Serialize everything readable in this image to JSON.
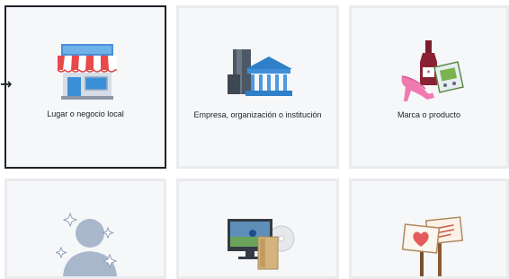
{
  "categories": [
    {
      "label": "Lugar o negocio local",
      "icon": "storefront-icon",
      "selected": true
    },
    {
      "label": "Empresa, organización o institución",
      "icon": "office-buildings-icon",
      "selected": false
    },
    {
      "label": "Marca o producto",
      "icon": "products-icon",
      "selected": false
    },
    {
      "label": "",
      "icon": "artist-figure-icon",
      "selected": false
    },
    {
      "label": "",
      "icon": "entertainment-media-icon",
      "selected": false
    },
    {
      "label": "",
      "icon": "cause-signs-icon",
      "selected": false
    }
  ],
  "selection_indicator": {
    "icon": "arrow-right-icon",
    "glyph": "→"
  },
  "colors": {
    "selected_border": "#1d2129",
    "tile_bg": "#f6f7f9",
    "tile_border": "#e9ebee"
  }
}
